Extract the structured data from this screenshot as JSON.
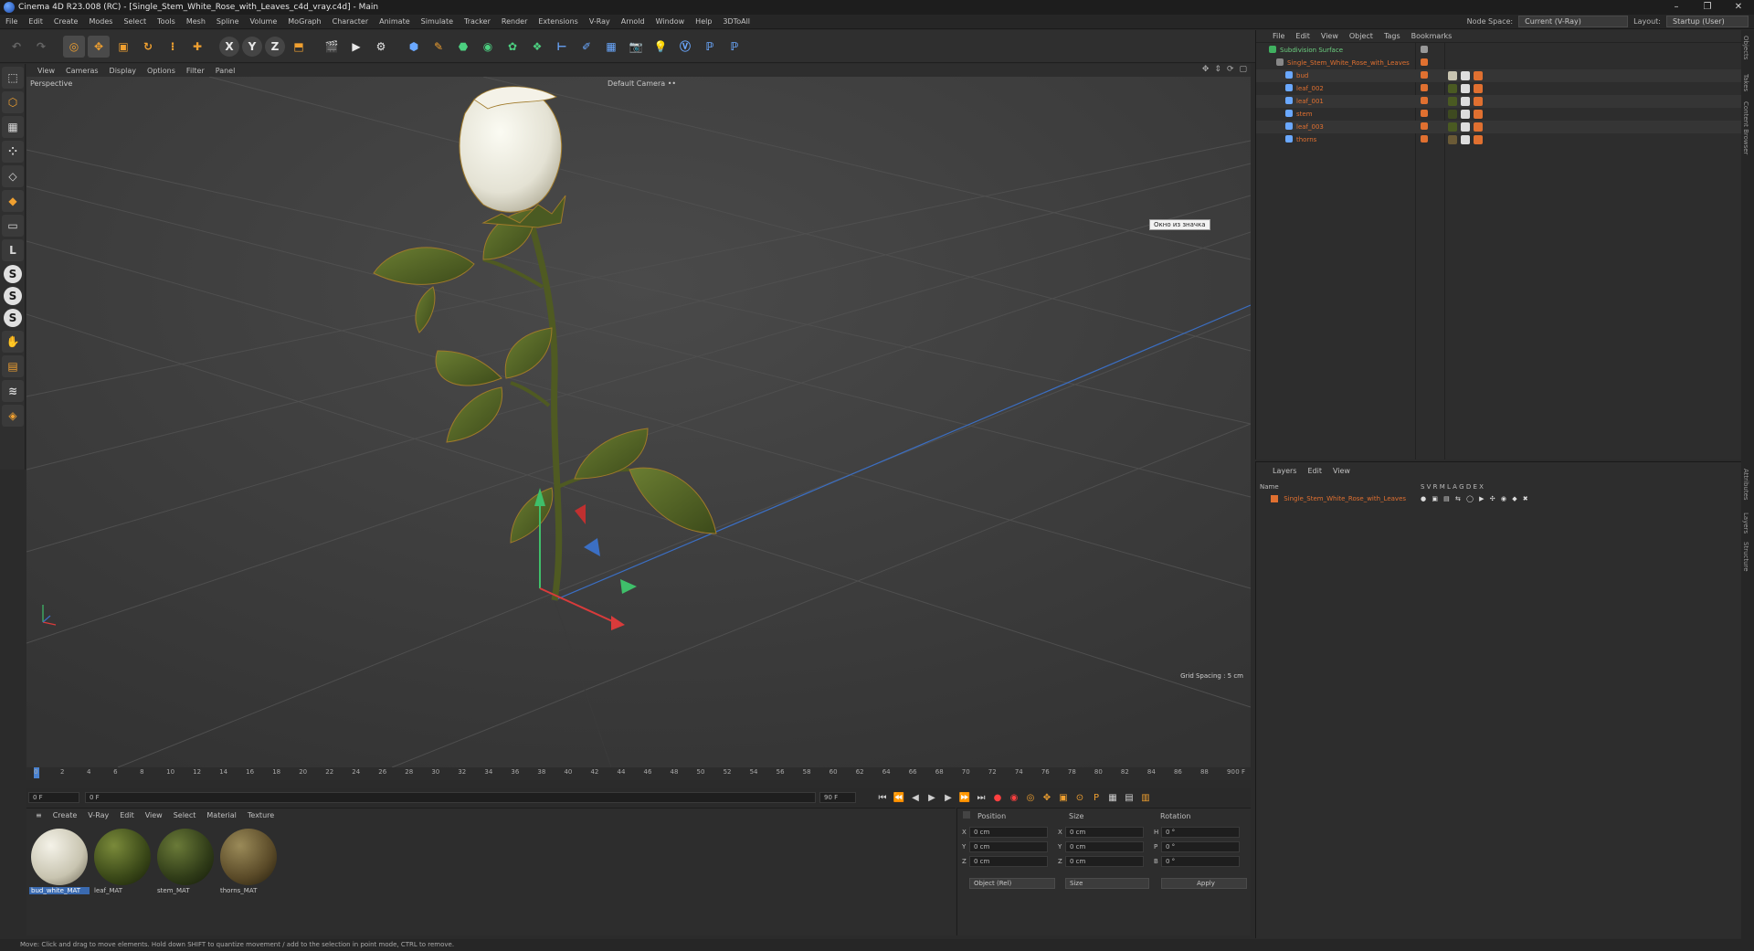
{
  "window": {
    "title": "Cinema 4D R23.008 (RC) - [Single_Stem_White_Rose_with_Leaves_c4d_vray.c4d] - Main",
    "controls": [
      "–",
      "❐",
      "✕"
    ]
  },
  "menubar": {
    "items": [
      "File",
      "Edit",
      "Create",
      "Modes",
      "Select",
      "Tools",
      "Mesh",
      "Spline",
      "Volume",
      "MoGraph",
      "Character",
      "Animate",
      "Simulate",
      "Tracker",
      "Render",
      "Extensions",
      "V-Ray",
      "Arnold",
      "Window",
      "Help",
      "3DToAll"
    ],
    "node_space_label": "Node Space:",
    "node_space_value": "Current (V-Ray)",
    "layout_label": "Layout:",
    "layout_value": "Startup (User)"
  },
  "viewport": {
    "menu": [
      "View",
      "Cameras",
      "Display",
      "Options",
      "Filter",
      "Panel"
    ],
    "label": "Perspective",
    "camera": "Default Camera ••",
    "tooltip": "Окно из значка",
    "grid_spacing": "Grid Spacing : 5 cm"
  },
  "timeline": {
    "ticks": [
      "0",
      "2",
      "4",
      "6",
      "8",
      "10",
      "12",
      "14",
      "16",
      "18",
      "20",
      "22",
      "24",
      "26",
      "28",
      "30",
      "32",
      "34",
      "36",
      "38",
      "40",
      "42",
      "44",
      "46",
      "48",
      "50",
      "52",
      "54",
      "56",
      "58",
      "60",
      "62",
      "64",
      "66",
      "68",
      "70",
      "72",
      "74",
      "76",
      "78",
      "80",
      "82",
      "84",
      "86",
      "88",
      "90"
    ],
    "current_frame": "0 F"
  },
  "transport": {
    "start": "0 F",
    "current": "0 F",
    "end": "90 F",
    "end2": "90 F"
  },
  "materials": {
    "menu": [
      "Create",
      "V-Ray",
      "Edit",
      "View",
      "Select",
      "Material",
      "Texture"
    ],
    "items": [
      {
        "name": "bud_white_MAT",
        "color": "#d8d4c4"
      },
      {
        "name": "leaf_MAT",
        "color": "#4a5a22"
      },
      {
        "name": "stem_MAT",
        "color": "#3e4a20"
      },
      {
        "name": "thorns_MAT",
        "color": "#6a5a36"
      }
    ]
  },
  "coords": {
    "headers": [
      "Position",
      "Size",
      "Rotation"
    ],
    "rows": [
      {
        "axis": "X",
        "pos": "0 cm",
        "size": "0 cm",
        "rot_label": "H",
        "rot": "0 °"
      },
      {
        "axis": "Y",
        "pos": "0 cm",
        "size": "0 cm",
        "rot_label": "P",
        "rot": "0 °"
      },
      {
        "axis": "Z",
        "pos": "0 cm",
        "size": "0 cm",
        "rot_label": "B",
        "rot": "0 °"
      }
    ],
    "mode": "Object (Rel)",
    "size_mode": "Size",
    "apply": "Apply"
  },
  "object_manager": {
    "menu": [
      "File",
      "Edit",
      "View",
      "Object",
      "Tags",
      "Bookmarks"
    ],
    "objects": [
      {
        "name": "Subdivision Surface",
        "type": "subdivision"
      },
      {
        "name": "Single_Stem_White_Rose_with_Leaves",
        "type": "null"
      },
      {
        "name": "bud",
        "type": "mesh"
      },
      {
        "name": "leaf_002",
        "type": "mesh"
      },
      {
        "name": "leaf_001",
        "type": "mesh"
      },
      {
        "name": "stem",
        "type": "mesh"
      },
      {
        "name": "leaf_003",
        "type": "mesh"
      },
      {
        "name": "thorns",
        "type": "mesh"
      }
    ]
  },
  "layer_manager": {
    "menu": [
      "Layers",
      "Edit",
      "View"
    ],
    "header_name": "Name",
    "header_flags": "S V R M L A G D E X",
    "layer": "Single_Stem_White_Rose_with_Leaves"
  },
  "right_strip": [
    "Objects",
    "Takes",
    "Content Browser",
    "Attributes",
    "Layers",
    "Structure"
  ],
  "status": "Move: Click and drag to move elements. Hold down SHIFT to quantize movement / add to the selection in point mode, CTRL to remove."
}
